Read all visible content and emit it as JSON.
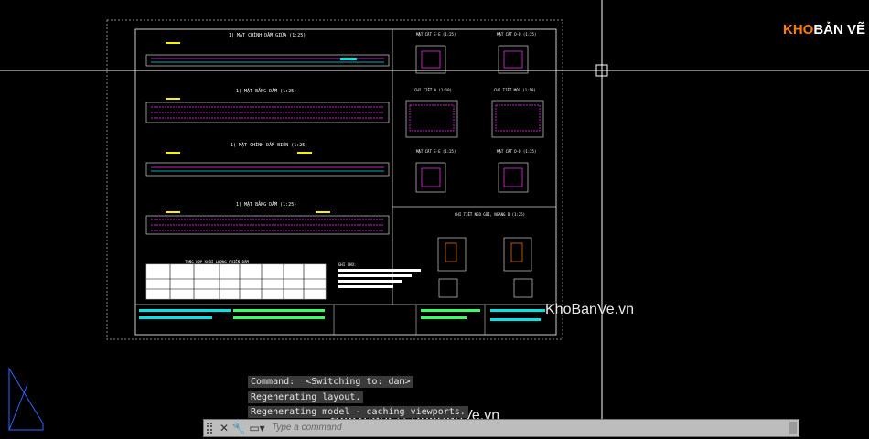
{
  "logo": {
    "part1": "KHO",
    "part2": "BẢN VẼ",
    "color1": "#ff7a00",
    "color2": "#ffffff"
  },
  "watermarks": {
    "site": "KhoBanVe.vn",
    "copyright": "Copyright © KhoBanVe.vn"
  },
  "drawing": {
    "views": [
      "1) MẶT CHÍNH DẦM GIỮA (1:25)",
      "1) MẶT BẰNG DẦM (1:25)",
      "1) MẶT CHÍNH DẦM BIÊN (1:25)",
      "1) MẶT BẰNG DẦM (1:25)"
    ],
    "sections": [
      "MẶT CẮT E-E (1:25)",
      "MẶT CẮT D-D (1:25)",
      "CHI TIẾT A (1:10)",
      "CHI TIẾT MÓC (1:10)",
      "MẶT CẮT E-E (1:25)",
      "MẶT CẮT D-D (1:25)"
    ],
    "detail_title": "CHI TIẾT NEO GỐI, NGANG D (1:25)",
    "table_title": "TỔNG HỢP KHỐI LƯỢNG PHIẾN DẦM",
    "notes_title": "GHI CHÚ:"
  },
  "command_history": [
    "Command:  <Switching to: dam>",
    "Regenerating layout.",
    "Regenerating model - caching viewports."
  ],
  "command_input": {
    "placeholder": "Type a command"
  },
  "colors": {
    "cad_bg": "#000000",
    "cyan": "#00e5e5",
    "yellow": "#ffee00",
    "magenta": "#ff33ff",
    "green": "#33ff66"
  }
}
